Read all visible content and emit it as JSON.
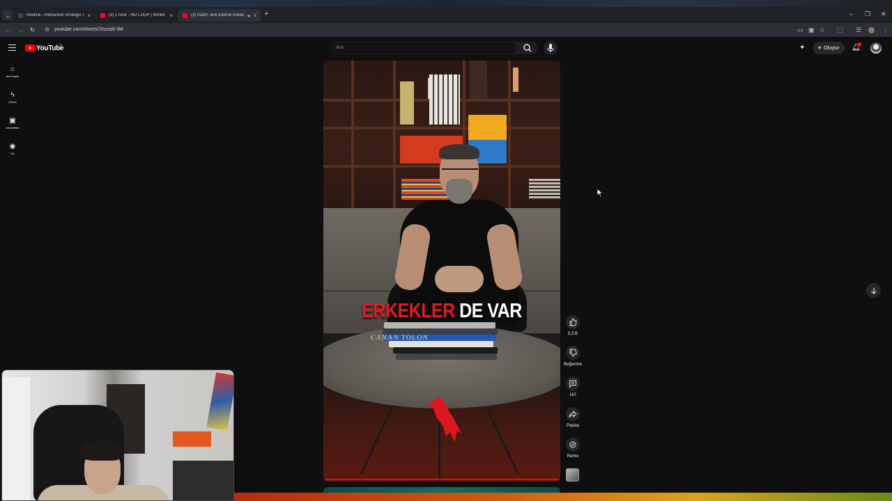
{
  "browser": {
    "tabs": [
      {
        "title": "Redline - Interactive Strategic I",
        "favicon_color": "#444444"
      },
      {
        "title": "(3) 1 hour - NO LOOP | Winter",
        "favicon_color": "#ff0033"
      },
      {
        "title": "(3) Kadın Terk Ederse Arkası",
        "favicon_color": "#ff0033"
      }
    ],
    "new_tab_icon": "plus-icon",
    "url": "youtube.com/shorts/JXzcizit-3M"
  },
  "yt": {
    "logo_text": "YouTube",
    "country_code": "TR",
    "search_placeholder": "Ara",
    "create_label": "Oluştur",
    "notification_count": "3"
  },
  "guide": [
    {
      "label": "Ana Sayfa",
      "icon": "home-icon"
    },
    {
      "label": "Shorts",
      "icon": "shorts-icon"
    },
    {
      "label": "Abonelikler",
      "icon": "subscriptions-icon"
    },
    {
      "label": "Siz",
      "icon": "you-icon"
    }
  ],
  "short": {
    "caption_red": "ERKEKLER",
    "caption_white": "DE VAR",
    "book_title": "CANAN TOLON"
  },
  "actions": {
    "like_count": "5,3 B",
    "dislike_label": "Beğenme",
    "comment_count": "167",
    "share_label": "Paylaş",
    "remix_label": "Remix"
  },
  "colors": {
    "accent": "#ff0000",
    "caption_red": "#e11b22"
  }
}
